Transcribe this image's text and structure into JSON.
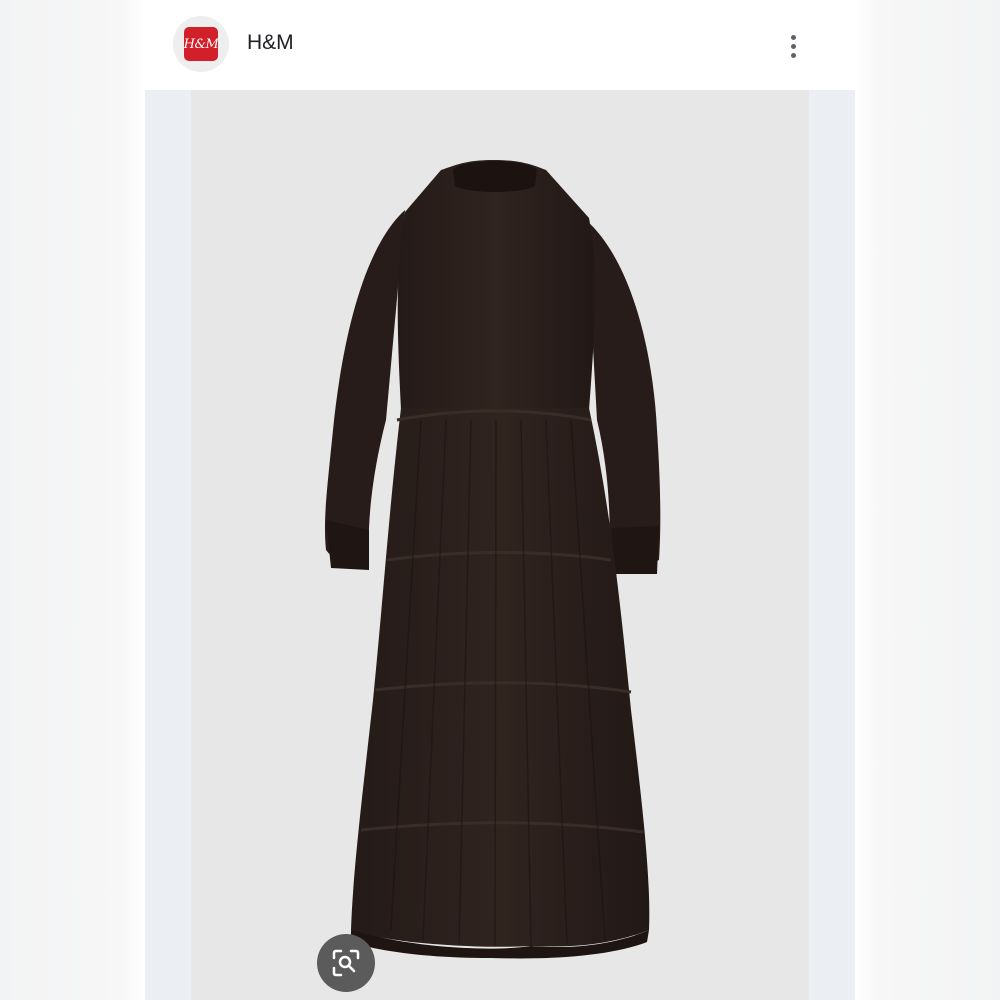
{
  "header": {
    "logo_text": "H&M",
    "brand_name": "H&M",
    "more_icon": "more-vert-icon"
  },
  "image": {
    "subject_icon": "dress-image"
  },
  "lens": {
    "icon": "lens-search-icon"
  },
  "colors": {
    "brand_red": "#d2202b",
    "dress": "#2a1f1c",
    "photo_background": "#e7e7e7"
  }
}
